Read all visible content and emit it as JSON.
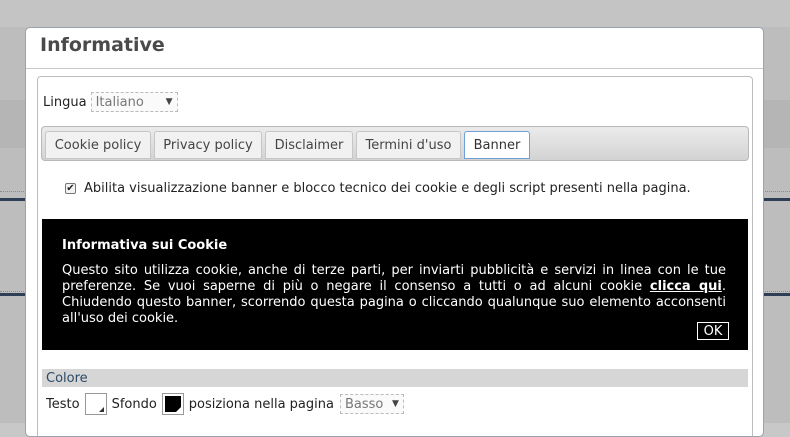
{
  "dialog": {
    "title": "Informative"
  },
  "language": {
    "label": "Lingua",
    "selected": "Italiano"
  },
  "tabs": [
    {
      "label": "Cookie policy",
      "active": false
    },
    {
      "label": "Privacy policy",
      "active": false
    },
    {
      "label": "Disclaimer",
      "active": false
    },
    {
      "label": "Termini d'uso",
      "active": false
    },
    {
      "label": "Banner",
      "active": true
    }
  ],
  "banner_settings": {
    "enable_label": "Abilita visualizzazione banner e blocco tecnico dei cookie e degli script presenti nella pagina.",
    "enabled": true
  },
  "preview": {
    "title": "Informativa sui Cookie",
    "text_1": "Questo sito utilizza cookie, anche di terze parti, per inviarti pubblicità e servizi in linea con le tue preferenze. Se vuoi saperne di più o negare il consenso a tutti o ad alcuni cookie ",
    "link": "clicca qui",
    "text_2": ". Chiudendo questo banner, scorrendo questa pagina o cliccando qualunque suo elemento acconsenti all'uso dei cookie.",
    "ok_label": "OK"
  },
  "colors_section": {
    "header": "Colore",
    "text_label": "Testo",
    "text_color": "#ffffff",
    "background_label": "Sfondo",
    "background_color": "#000000",
    "position_label": "posiziona nella pagina",
    "position_value": "Basso"
  }
}
